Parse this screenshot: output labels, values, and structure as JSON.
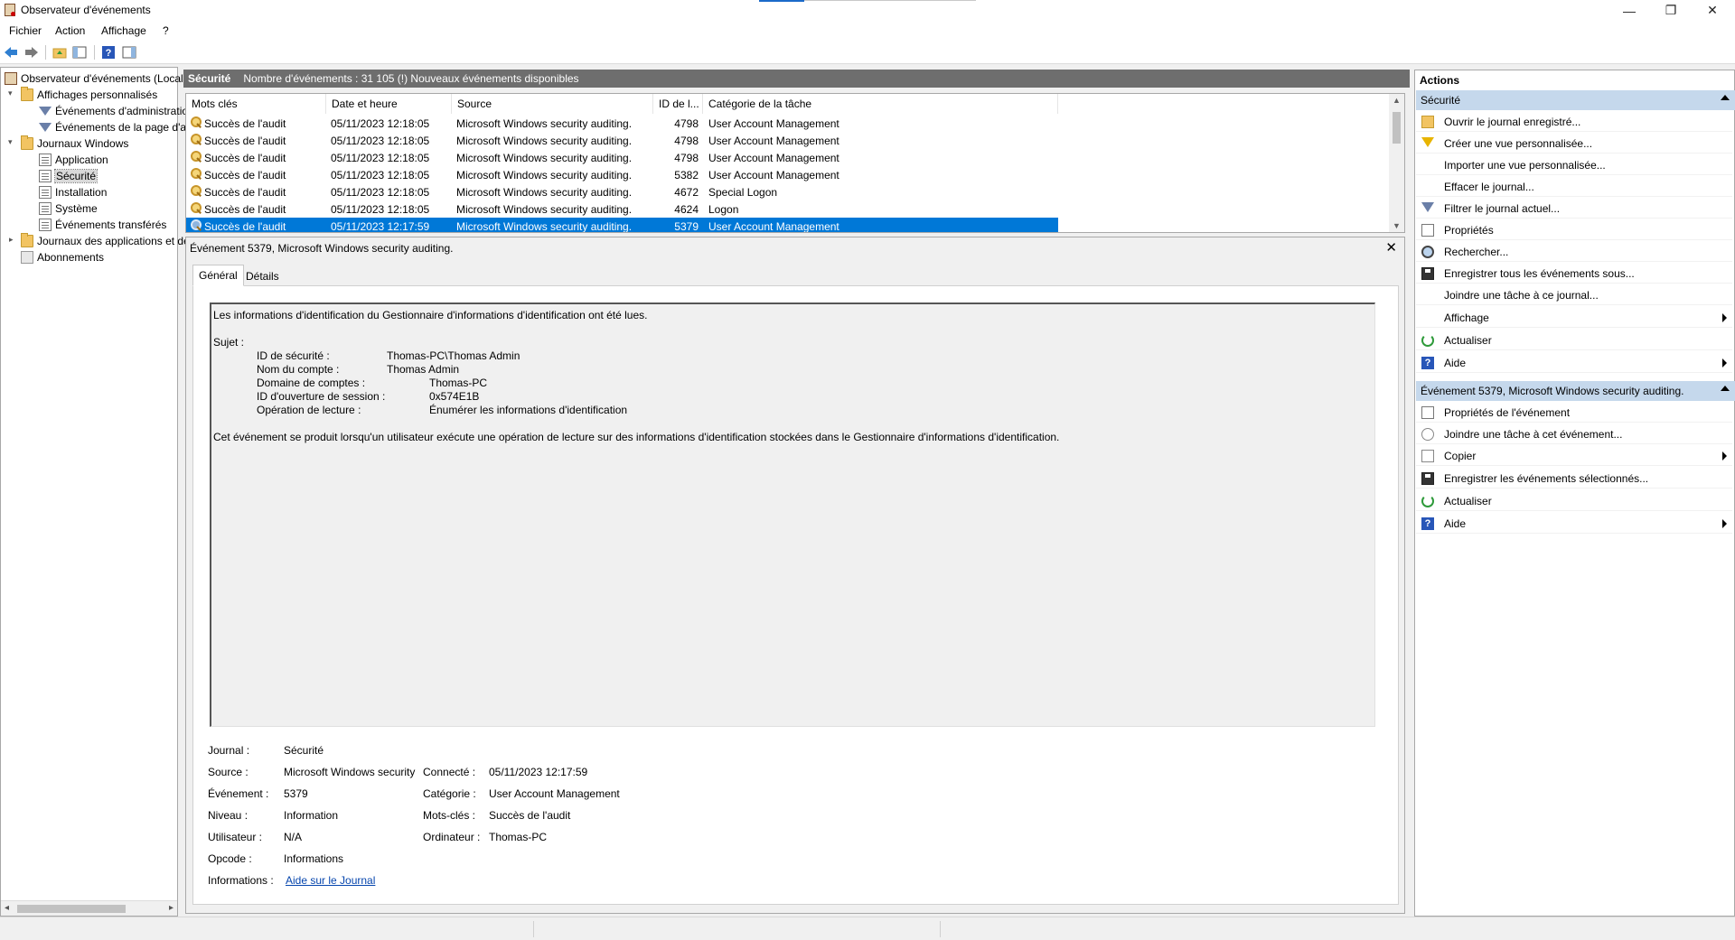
{
  "window": {
    "title": "Observateur d'événements",
    "controls": {
      "minimize": "—",
      "restore": "❐",
      "close": "✕"
    }
  },
  "menu": [
    "Fichier",
    "Action",
    "Affichage",
    "?"
  ],
  "tree": {
    "root": "Observateur d'événements (Local)",
    "custom_views": "Affichages personnalisés",
    "custom_children": [
      "Événements d'administration",
      "Événements de la page d'accueil"
    ],
    "windows_logs": "Journaux Windows",
    "windows_children": [
      "Application",
      "Sécurité",
      "Installation",
      "Système",
      "Événements transférés"
    ],
    "app_logs": "Journaux des applications et des services",
    "subscriptions": "Abonnements"
  },
  "center_header": {
    "title": "Sécurité",
    "info": "Nombre d'événements : 31 105 (!) Nouveaux événements disponibles"
  },
  "event_list": {
    "columns": [
      "Mots clés",
      "Date et heure",
      "Source",
      "ID de l...",
      "Catégorie de la tâche"
    ],
    "rows": [
      [
        "Succès de l'audit",
        "05/11/2023 12:18:05",
        "Microsoft Windows security auditing.",
        "4798",
        "User Account Management"
      ],
      [
        "Succès de l'audit",
        "05/11/2023 12:18:05",
        "Microsoft Windows security auditing.",
        "4798",
        "User Account Management"
      ],
      [
        "Succès de l'audit",
        "05/11/2023 12:18:05",
        "Microsoft Windows security auditing.",
        "4798",
        "User Account Management"
      ],
      [
        "Succès de l'audit",
        "05/11/2023 12:18:05",
        "Microsoft Windows security auditing.",
        "5382",
        "User Account Management"
      ],
      [
        "Succès de l'audit",
        "05/11/2023 12:18:05",
        "Microsoft Windows security auditing.",
        "4672",
        "Special Logon"
      ],
      [
        "Succès de l'audit",
        "05/11/2023 12:18:05",
        "Microsoft Windows security auditing.",
        "4624",
        "Logon"
      ],
      [
        "Succès de l'audit",
        "05/11/2023 12:17:59",
        "Microsoft Windows security auditing.",
        "5379",
        "User Account Management"
      ]
    ],
    "selected_index": 6
  },
  "detail": {
    "title": "Événement 5379, Microsoft Windows security auditing.",
    "tabs": [
      "Général",
      "Détails"
    ],
    "description": {
      "line1": "Les informations d'identification du Gestionnaire d'informations d'identification ont été lues.",
      "subject_label": "Sujet :",
      "fields": [
        {
          "label": "ID de sécurité :",
          "value": "Thomas-PC\\Thomas Admin"
        },
        {
          "label": "Nom du compte :",
          "value": "Thomas Admin"
        },
        {
          "label": "Domaine de comptes :",
          "value": "Thomas-PC"
        },
        {
          "label": "ID d'ouverture de session :",
          "value": "0x574E1B"
        },
        {
          "label": "Opération de lecture :",
          "value": "Énumérer les informations d'identification"
        }
      ],
      "footer": "Cet événement se produit lorsqu'un utilisateur exécute une opération de lecture sur des informations d'identification stockées dans le Gestionnaire d'informations d'identification."
    },
    "meta": {
      "journal_label": "Journal :",
      "journal": "Sécurité",
      "source_label": "Source :",
      "source": "Microsoft Windows security",
      "connecte_label": "Connecté :",
      "connecte": "05/11/2023 12:17:59",
      "evenement_label": "Événement :",
      "evenement": "5379",
      "categorie_label": "Catégorie :",
      "categorie": "User Account Management",
      "niveau_label": "Niveau :",
      "niveau": "Information",
      "motscles_label": "Mots-clés :",
      "motscles": "Succès de l'audit",
      "utilisateur_label": "Utilisateur :",
      "utilisateur": "N/A",
      "ordinateur_label": "Ordinateur :",
      "ordinateur": "Thomas-PC",
      "opcode_label": "Opcode :",
      "opcode": "Informations",
      "informations_label": "Informations :",
      "informations_link": "Aide sur le Journal"
    }
  },
  "actions": {
    "title": "Actions",
    "section1": "Sécurité",
    "section1_items": [
      "Ouvrir le journal enregistré...",
      "Créer une vue personnalisée...",
      "Importer une vue personnalisée...",
      "Effacer le journal...",
      "Filtrer le journal actuel...",
      "Propriétés",
      "Rechercher...",
      "Enregistrer tous les événements sous...",
      "Joindre une tâche à ce journal...",
      "Affichage",
      "Actualiser",
      "Aide"
    ],
    "section2": "Événement 5379, Microsoft Windows security auditing.",
    "section2_items": [
      "Propriétés de l'événement",
      "Joindre une tâche à cet événement...",
      "Copier",
      "Enregistrer les événements sélectionnés...",
      "Actualiser",
      "Aide"
    ]
  },
  "colors": {
    "accent": "#0078d7",
    "header_bg": "#6e6e6e",
    "section_bg": "#c5d8ec"
  }
}
